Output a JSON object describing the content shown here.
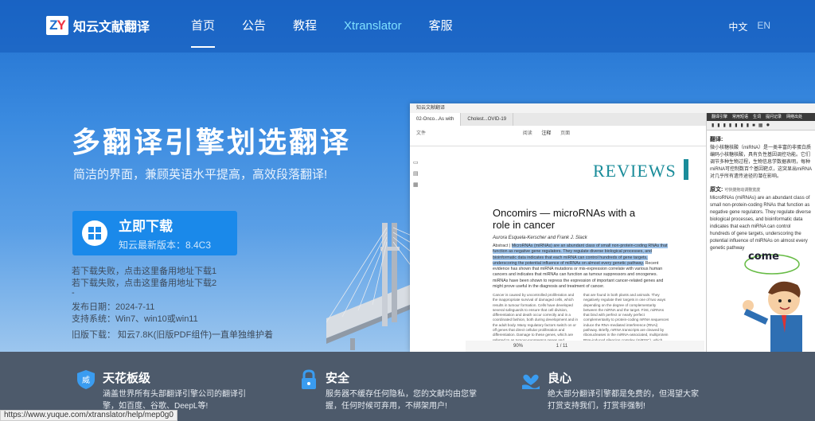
{
  "logo": {
    "mark_z": "Z",
    "mark_y": "Y",
    "text": "知云文献翻译"
  },
  "nav": {
    "items": [
      {
        "label": "首页"
      },
      {
        "label": "公告"
      },
      {
        "label": "教程"
      },
      {
        "label": "Xtranslator"
      },
      {
        "label": "客服"
      }
    ],
    "lang_zh": "中文",
    "lang_en": "EN"
  },
  "hero": {
    "headline": "多翻译引擎划选翻译",
    "subtitle": "简洁的界面，兼顾英语水平提高，高效段落翻译!",
    "download": {
      "title": "立即下载",
      "version": "知云最新版本：8.4C3"
    },
    "backup1": "若下载失败，点击这里备用地址下载1",
    "backup2": "若下载失败，点击这里备用地址下载2",
    "dash": "-",
    "release": "发布日期：2024-7-11",
    "support": "支持系统：Win7、win10或win11",
    "old": "旧版下载：  知云7.8K(旧版PDF组件)一直单独维护着"
  },
  "app_screenshot": {
    "window_title": "知云文献翻译",
    "tab1": "02-Onco...As with",
    "tab2": "Cholest...OVID-19",
    "toolbar_file": "文件",
    "toolbar_view": "阅读",
    "toolbar_annotate": "注释",
    "toolbar_page": "页面",
    "reviews": "REVIEWS",
    "article_title": "Oncomirs — microRNAs with a role in cancer",
    "authors": "Aurora Esquela-Kerscher and Frank J. Slack",
    "abstract_label": "Abstract | ",
    "abstract_hl": "MicroRNAs (miRNAs) are an abundant class of small non-protein-coding RNAs that function as negative gene regulators. They regulate diverse biological processes, and bioinformatic data indicates that each miRNA can control hundreds of gene targets, underscoring the potential influence of miRNAs on almost every genetic pathway.",
    "abstract_rest": " Recent evidence has shown that miRNA mutations or mis-expression correlate with various human cancers and indicates that miRNAs can function as tumour suppressors and oncogenes. miRNAs have been shown to repress the expression of important cancer-related genes and might prove useful in the diagnosis and treatment of cancer.",
    "col1": "Cancer is caused by uncontrolled proliferation and the inappropriate survival of damaged cells, which results in tumour formation. Cells have developed several safeguards to ensure that cell division, differentiation and death occur correctly and in a coordinated fashion, both during development and in the adult body. Many regulatory factors switch on or off genes that direct cellular proliferation and differentiation. Damage to these genes, which are referred to as tumour-suppressor genes and oncogenes, is selected for in cancer. Most tumour-",
    "col2": "that are found in both plants and animals. They negatively regulate their targets in one of two ways depending on the degree of complementarity between the miRNA and the target. First, miRNAs that bind with perfect or nearly perfect complementarity to protein-coding mRNA sequences induce the RNA-mediated interference (RNAi) pathway. Briefly, mRNA transcripts are cleaved by ribonucleases in the miRNA-associated, multiprotein RNA-induced silencing complex (miRISC), which results in the degradation of target mRNAs. This mechanism of miRNA-mediated gene silencing has been found abundantly in plants",
    "status_zoom": "90%",
    "status_page": "1 / 11",
    "panel_tab1": "翻译引擎",
    "panel_tab2": "常用短语",
    "panel_tab3": "生词",
    "panel_tab4": "提问记录",
    "panel_tab5": "网络出处",
    "panel_translate_head": "翻译:",
    "panel_translate_body": "微小核糖核酸（miRNA）是一类丰富的非蛋白质编码小核糖核酸，具有负性基因调控功能。它们调节多种生物过程，生物信息学数据表明，每种miRNA可控制数百个基因靶点，这突显出miRNA对几乎所有遗传途径的潜在影响。",
    "panel_orig_head": "原文:",
    "panel_orig_sub": "可快捷拖动调整宽度",
    "panel_orig_body": "MicroRNAs (miRNAs) are an abundant class of small non-protein-coding RNAs that function as negative gene regulators. They regulate diverse biological processes, and bioinformatic data indicates that each miRNA can control hundreds of gene targets, underscoring the potential influence of miRNAs on almost every genetic pathway"
  },
  "cartoon": {
    "speech": "come"
  },
  "features": [
    {
      "icon": "shield-badge-icon",
      "title": "天花板级",
      "desc": "涵盖世界所有头部翻译引擎公司的翻译引擎，如百度、谷歌、DeepL等!",
      "color": "#3a9cf0"
    },
    {
      "icon": "lock-icon",
      "title": "安全",
      "desc": "服务器不缓存任何隐私，您的文献均由您掌握，任何时候可弃用，不绑架用户!",
      "color": "#3a9cf0"
    },
    {
      "icon": "hand-heart-icon",
      "title": "良心",
      "desc": "绝大部分翻译引擎都是免费的，但渴望大家打赏支持我们，打赏非强制!",
      "color": "#3a9cf0"
    }
  ],
  "status_url": "https://www.yuque.com/xtranslator/help/mep0g0"
}
